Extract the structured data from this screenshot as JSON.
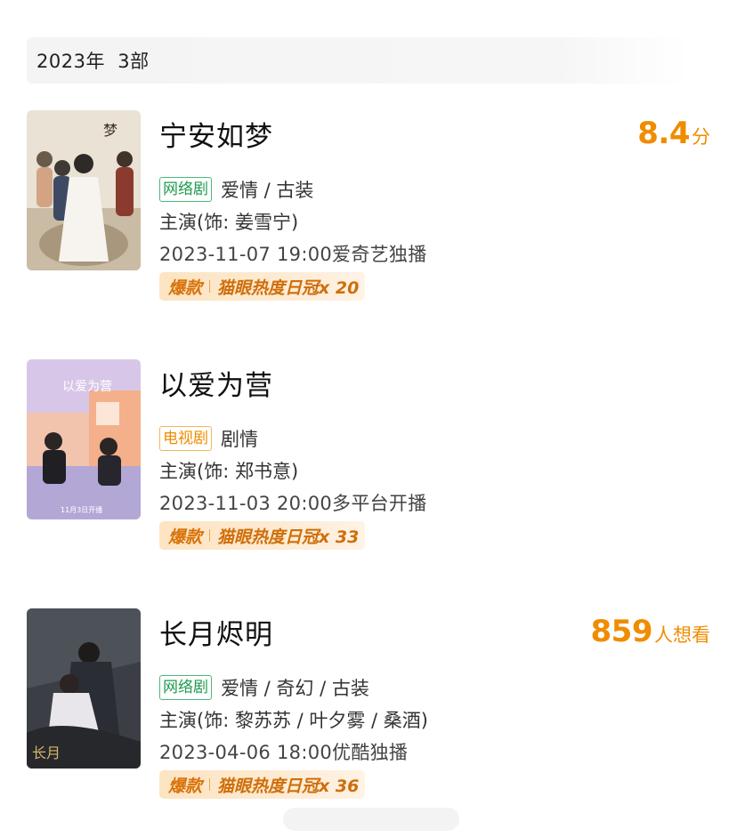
{
  "header": {
    "year_label": "2023年  3部"
  },
  "items": [
    {
      "title": "宁安如梦",
      "score_value": "8.4",
      "score_unit": "分",
      "type": "网络剧",
      "genres": "爱情 / 古装",
      "cast": "主演(饰:  姜雪宁)",
      "release": "2023-11-07 19:00爱奇艺独播",
      "hot_tag": "爆款",
      "hot_text": "猫眼热度日冠x 20"
    },
    {
      "title": "以爱为营",
      "score_value": "",
      "score_unit": "",
      "type": "电视剧",
      "genres": "剧情",
      "cast": "主演(饰: 郑书意)",
      "release": "2023-11-03 20:00多平台开播",
      "hot_tag": "爆款",
      "hot_text": "猫眼热度日冠x 33"
    },
    {
      "title": "长月烬明",
      "score_value": "859",
      "score_unit": "人想看",
      "type": "网络剧",
      "genres": "爱情 / 奇幻 / 古装",
      "cast": "主演(饰: 黎苏苏 / 叶夕雾 / 桑酒)",
      "release": "2023-04-06 18:00优酷独播",
      "hot_tag": "爆款",
      "hot_text": "猫眼热度日冠x 36"
    }
  ],
  "colors": {
    "accent": "#f08c00",
    "web_badge": "#1f9a4f",
    "hot_bg": "#fde4c2"
  }
}
